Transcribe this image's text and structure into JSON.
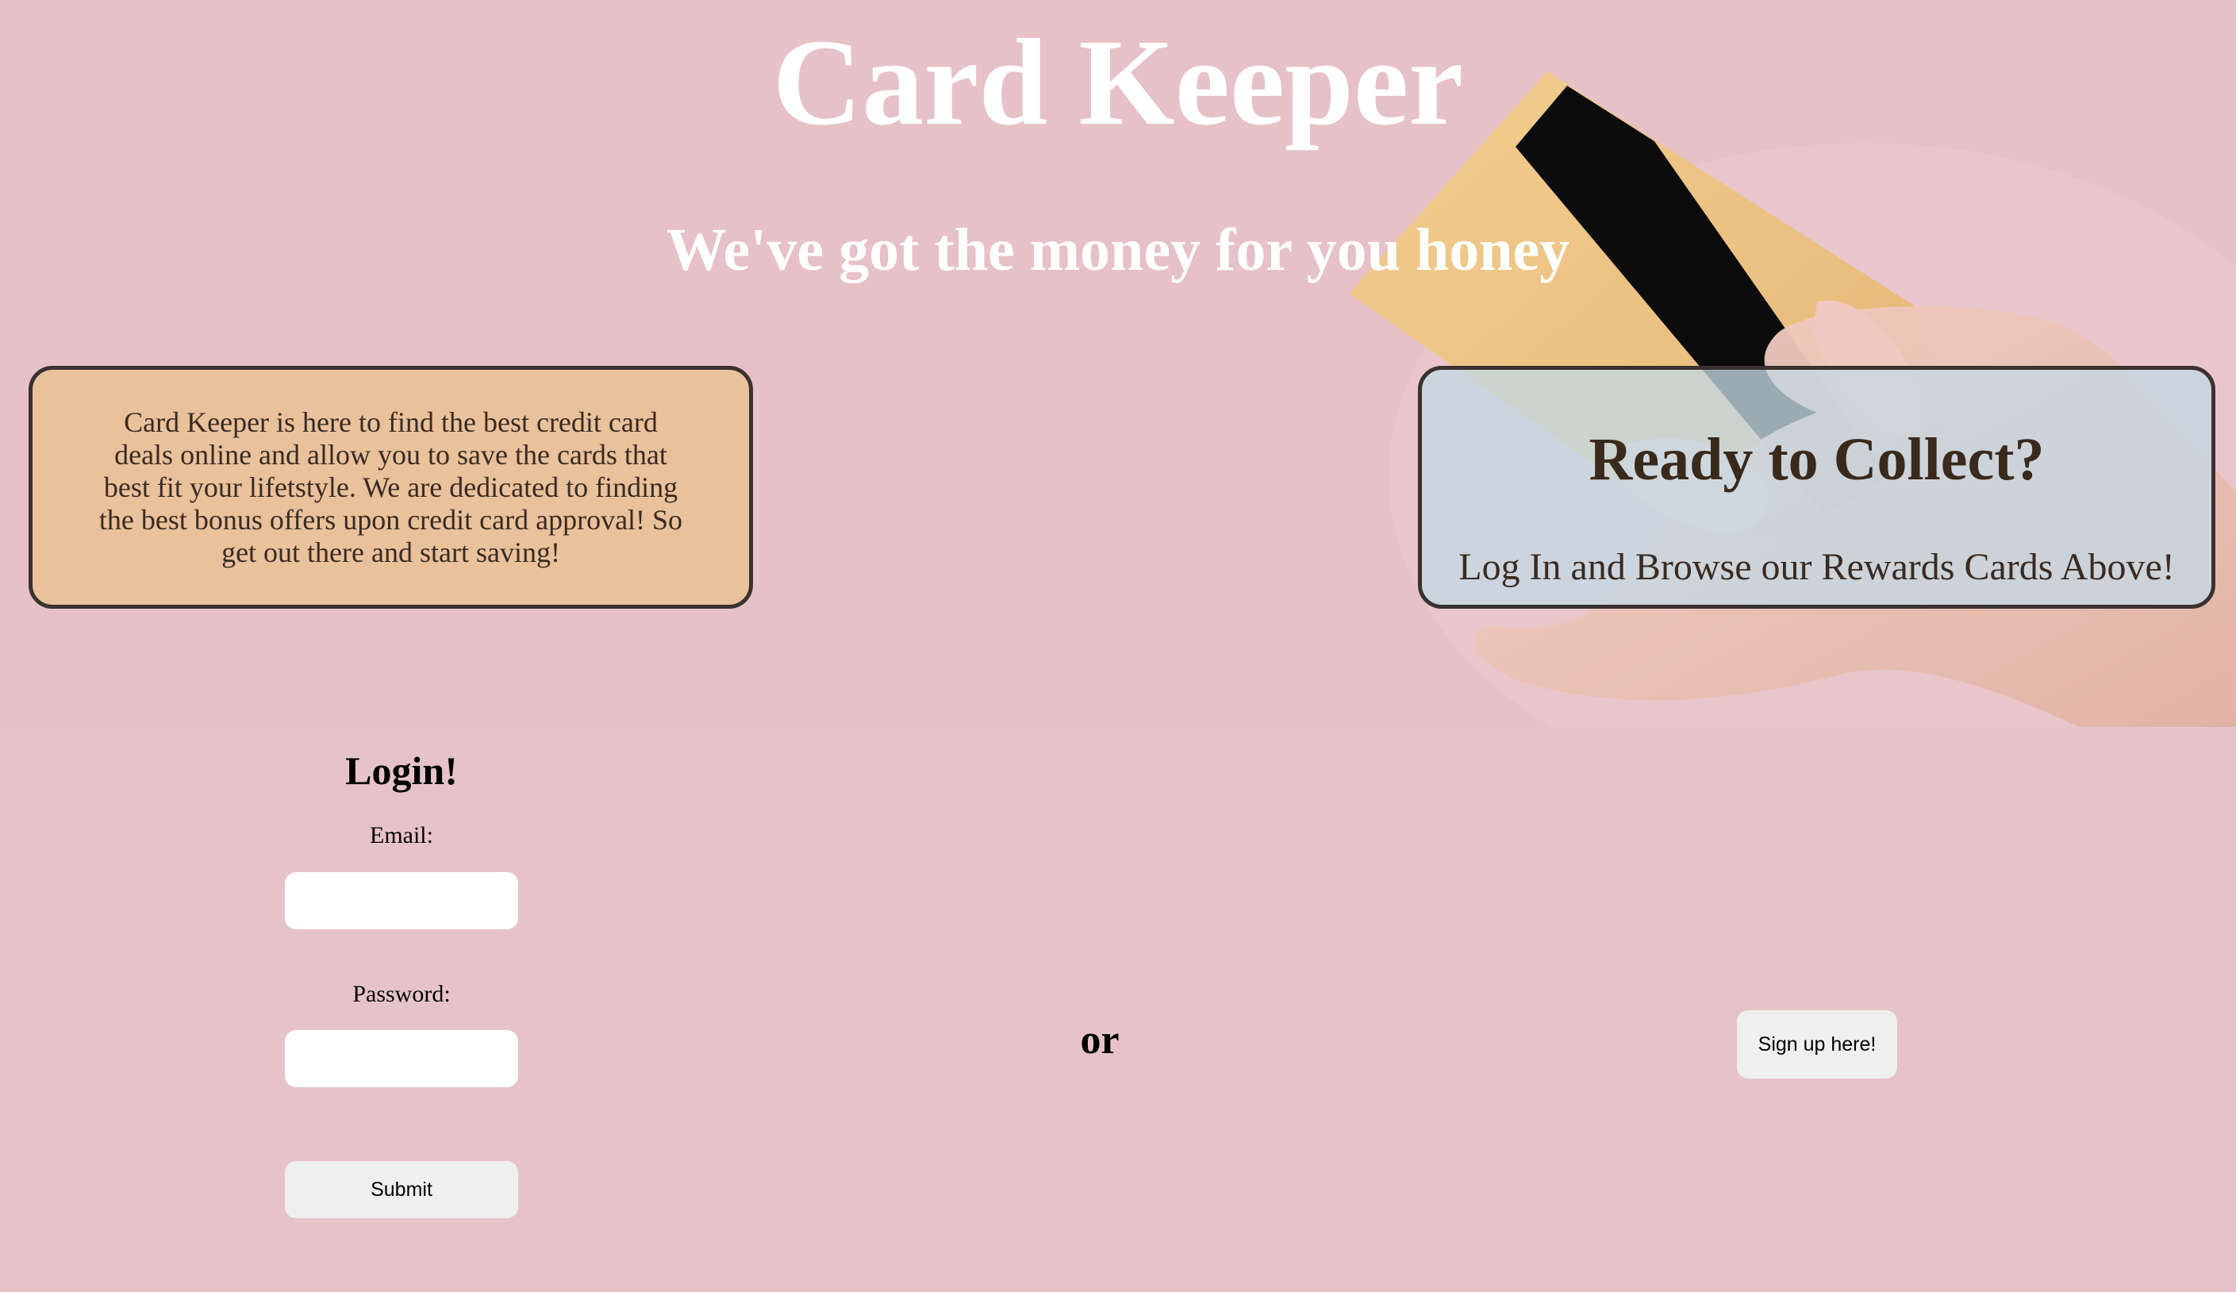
{
  "hero": {
    "title": "Card Keeper",
    "tagline": "We've got the money for you honey"
  },
  "about": {
    "text": "Card Keeper is here to find the best credit card deals online and allow you to save the cards that best fit your lifetstyle. We are dedicated to finding the best bonus offers upon credit card approval! So get out there and start saving!"
  },
  "cta": {
    "title": "Ready to Collect?",
    "text": "Log In and Browse our Rewards Cards Above!"
  },
  "login": {
    "title": "Login!",
    "email_label": "Email:",
    "password_label": "Password:",
    "submit_label": "Submit"
  },
  "or_text": "or",
  "signup": {
    "label": "Sign up here!"
  },
  "colors": {
    "page_background": "#e6c3c8",
    "about_box": "#e9c19b",
    "cta_box": "#c4d8e4",
    "box_border": "#3a3230"
  }
}
